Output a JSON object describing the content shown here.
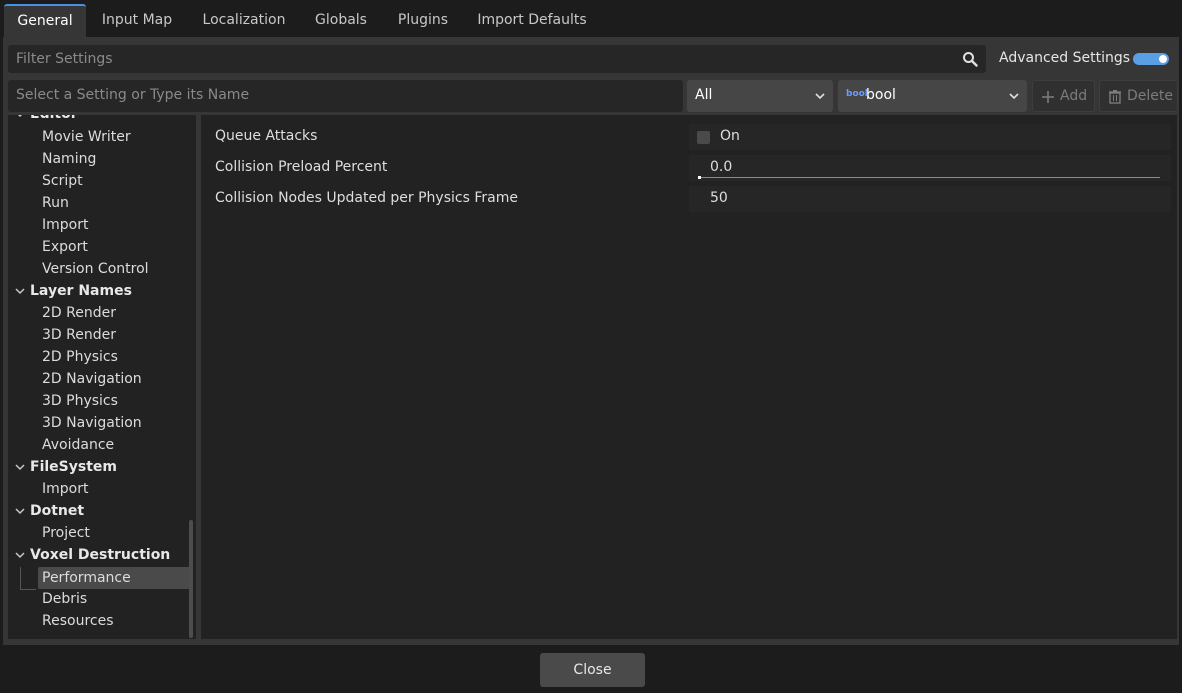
{
  "tabs": [
    {
      "label": "General",
      "active": true
    },
    {
      "label": "Input Map"
    },
    {
      "label": "Localization"
    },
    {
      "label": "Globals"
    },
    {
      "label": "Plugins"
    },
    {
      "label": "Import Defaults"
    }
  ],
  "filter": {
    "placeholder": "Filter Settings",
    "icon": "search-icon"
  },
  "advanced_settings": {
    "label": "Advanced Settings",
    "enabled": true
  },
  "add_bar": {
    "placeholder": "Select a Setting or Type its Name",
    "scope_value": "All",
    "type_value": "bool",
    "type_icon_text": "bool",
    "add_label": "Add",
    "delete_label": "Delete"
  },
  "tree": {
    "items": [
      {
        "label": "Editor",
        "kind": "cat"
      },
      {
        "label": "Movie Writer",
        "kind": "item"
      },
      {
        "label": "Naming",
        "kind": "item"
      },
      {
        "label": "Script",
        "kind": "item"
      },
      {
        "label": "Run",
        "kind": "item"
      },
      {
        "label": "Import",
        "kind": "item"
      },
      {
        "label": "Export",
        "kind": "item"
      },
      {
        "label": "Version Control",
        "kind": "item"
      },
      {
        "label": "Layer Names",
        "kind": "cat"
      },
      {
        "label": "2D Render",
        "kind": "item"
      },
      {
        "label": "3D Render",
        "kind": "item"
      },
      {
        "label": "2D Physics",
        "kind": "item"
      },
      {
        "label": "2D Navigation",
        "kind": "item"
      },
      {
        "label": "3D Physics",
        "kind": "item"
      },
      {
        "label": "3D Navigation",
        "kind": "item"
      },
      {
        "label": "Avoidance",
        "kind": "item"
      },
      {
        "label": "FileSystem",
        "kind": "cat"
      },
      {
        "label": "Import",
        "kind": "item"
      },
      {
        "label": "Dotnet",
        "kind": "cat"
      },
      {
        "label": "Project",
        "kind": "item"
      },
      {
        "label": "Voxel Destruction",
        "kind": "cat"
      },
      {
        "label": "Performance",
        "kind": "item",
        "selected": true
      },
      {
        "label": "Debris",
        "kind": "item"
      },
      {
        "label": "Resources",
        "kind": "item"
      }
    ]
  },
  "properties": [
    {
      "name": "Queue Attacks",
      "type": "bool",
      "value_label": "On",
      "checked": false
    },
    {
      "name": "Collision Preload Percent",
      "type": "slider",
      "value": "0.0",
      "fraction": 0.0
    },
    {
      "name": "Collision Nodes Updated per Physics Frame",
      "type": "int",
      "value": "50"
    }
  ],
  "close_label": "Close"
}
